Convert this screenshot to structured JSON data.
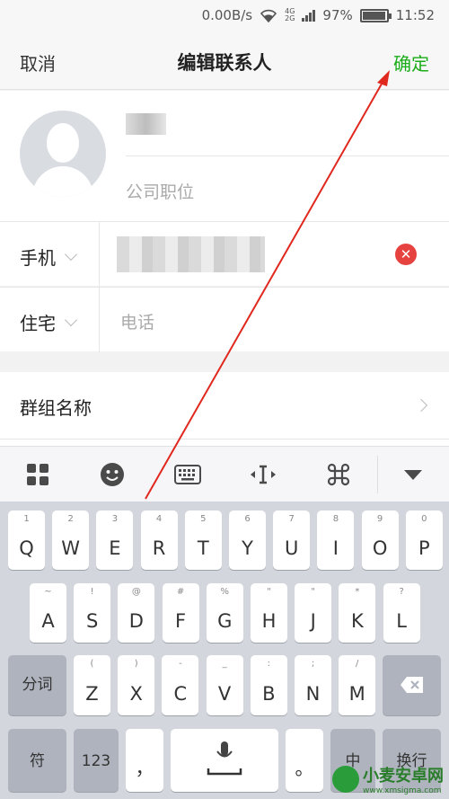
{
  "status_bar": {
    "net_speed": "0.00B/s",
    "network": "4G\n2G",
    "battery": "97%",
    "battery_level": 0.97,
    "time": "11:52"
  },
  "header": {
    "cancel": "取消",
    "title": "编辑联系人",
    "confirm": "确定",
    "confirm_color": "#1aad19"
  },
  "profile": {
    "position_placeholder": "公司职位"
  },
  "fields": [
    {
      "label": "手机"
    },
    {
      "label": "住宅",
      "placeholder": "电话"
    }
  ],
  "group": {
    "label": "群组名称"
  },
  "kb_toolbar": [
    "apps-grid-icon",
    "emoji-icon",
    "keyboard-icon",
    "cursor-icon",
    "command-icon",
    "collapse-icon"
  ],
  "keyboard": {
    "row1": [
      {
        "k": "Q",
        "h": "1"
      },
      {
        "k": "W",
        "h": "2"
      },
      {
        "k": "E",
        "h": "3"
      },
      {
        "k": "R",
        "h": "4"
      },
      {
        "k": "T",
        "h": "5"
      },
      {
        "k": "Y",
        "h": "6"
      },
      {
        "k": "U",
        "h": "7"
      },
      {
        "k": "I",
        "h": "8"
      },
      {
        "k": "O",
        "h": "9"
      },
      {
        "k": "P",
        "h": "0"
      }
    ],
    "row2": [
      {
        "k": "A",
        "h": "~"
      },
      {
        "k": "S",
        "h": "!"
      },
      {
        "k": "D",
        "h": "@"
      },
      {
        "k": "F",
        "h": "#"
      },
      {
        "k": "G",
        "h": "%"
      },
      {
        "k": "H",
        "h": "\""
      },
      {
        "k": "J",
        "h": "\""
      },
      {
        "k": "K",
        "h": "*"
      },
      {
        "k": "L",
        "h": "?"
      }
    ],
    "fen_ci": "分词",
    "row3": [
      {
        "k": "Z",
        "h": "("
      },
      {
        "k": "X",
        "h": ")"
      },
      {
        "k": "C",
        "h": "-"
      },
      {
        "k": "V",
        "h": "_"
      },
      {
        "k": "B",
        "h": ":"
      },
      {
        "k": "N",
        "h": ";"
      },
      {
        "k": "M",
        "h": "/"
      }
    ],
    "symbol": "符",
    "num": "123",
    "comma": "，",
    "period": "。",
    "zh": "中",
    "newline": "换行"
  },
  "watermark": {
    "name": "小麦安卓网",
    "url": "www.xmsigma.com"
  },
  "colors": {
    "accent": "#1aad19",
    "clear": "#e64340",
    "arrow": "#e0281e"
  }
}
